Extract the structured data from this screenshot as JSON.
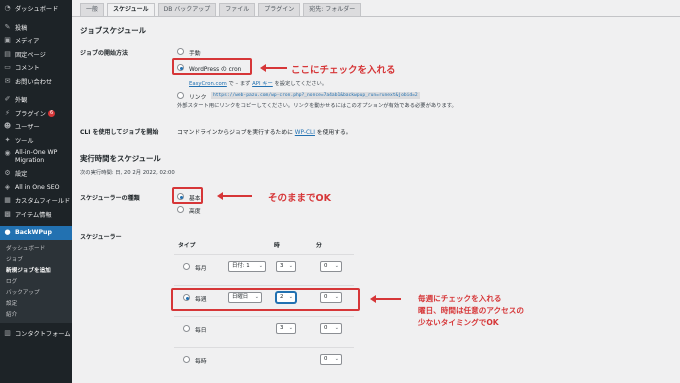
{
  "sidebar": {
    "items": [
      {
        "label": "ダッシュボード",
        "icon": "dashboard-icon",
        "glyph": "◔"
      },
      {
        "label": "投稿",
        "icon": "pin-icon",
        "glyph": "✎"
      },
      {
        "label": "メディア",
        "icon": "media-icon",
        "glyph": "▣"
      },
      {
        "label": "固定ページ",
        "icon": "page-icon",
        "glyph": "▤"
      },
      {
        "label": "コメント",
        "icon": "comment-icon",
        "glyph": "▭"
      },
      {
        "label": "お問い合わせ",
        "icon": "mail-icon",
        "glyph": "✉"
      },
      {
        "label": "外観",
        "icon": "brush-icon",
        "glyph": "✐"
      },
      {
        "label": "プラグイン",
        "icon": "plugin-icon",
        "glyph": "⚡",
        "badge": "6"
      },
      {
        "label": "ユーザー",
        "icon": "user-icon",
        "glyph": "☻"
      },
      {
        "label": "ツール",
        "icon": "wrench-icon",
        "glyph": "✦"
      },
      {
        "label": "All-in-One WP Migration",
        "icon": "migration-icon",
        "glyph": "◉"
      },
      {
        "label": "設定",
        "icon": "settings-icon",
        "glyph": "⚙"
      },
      {
        "label": "All in One SEO",
        "icon": "seo-icon",
        "glyph": "◈"
      },
      {
        "label": "カスタムフィールド",
        "icon": "fields-icon",
        "glyph": "▦"
      },
      {
        "label": "アイテム情報",
        "icon": "item-icon",
        "glyph": "▩"
      },
      {
        "label": "BackWPup",
        "icon": "backwpup-icon",
        "glyph": "●"
      },
      {
        "label": "コンタクトフォーム",
        "icon": "contact-form-icon",
        "glyph": "▥"
      }
    ],
    "submenu": [
      "ダッシュボード",
      "ジョブ",
      "新規ジョブを追加",
      "ログ",
      "バックアップ",
      "設定",
      "紹介"
    ]
  },
  "tabs": [
    "一般",
    "スケジュール",
    "DB バックアップ",
    "ファイル",
    "プラグイン",
    "宛先: フォルダー"
  ],
  "job_schedule": {
    "heading": "ジョブスケジュール",
    "start_label": "ジョブの開始方法",
    "opt_manual": "手動",
    "opt_wpcron": "WordPress の cron",
    "easycron_link": "EasyCron.com",
    "easycron_mid": " で – まず ",
    "api_key_link": "API キー",
    "easycron_tail": " を設定してください。",
    "opt_link": "リンク",
    "link_url": "https://web-pazu.com/wp-cron.php?_nonce=7a4ab1&backwpup_run=runext&jobid=2",
    "link_desc": "外部スタート用にリンクをコピーしてください。リンクを動かせるにはこのオプションが有効である必要があります。",
    "cli_label": "CLI を使用してジョブを開始",
    "cli_text_pre": "コマンドラインからジョブを実行するために ",
    "cli_link": "WP-CLI",
    "cli_text_post": " を使用する。"
  },
  "run_schedule": {
    "heading": "実行時間をスケジュール",
    "next_run": "次の実行時間: 日, 20 2月 2022, 02:00",
    "type_label": "スケジューラーの種類",
    "opt_basic": "基本",
    "opt_advanced": "高度",
    "scheduler_label": "スケジューラー",
    "col_type": "タイプ",
    "col_hour": "時",
    "col_min": "分",
    "rows": [
      {
        "label": "毎月",
        "day": "日付: 1",
        "hour": "3",
        "min": "0"
      },
      {
        "label": "毎週",
        "day": "日曜日",
        "hour": "2",
        "min": "0"
      },
      {
        "label": "毎日",
        "day": "",
        "hour": "3",
        "min": "0"
      },
      {
        "label": "毎時",
        "day": "",
        "hour": "",
        "min": "0"
      }
    ]
  },
  "annotations": {
    "cron": "ここにチェックを入れる",
    "basic": "そのままでOK",
    "weekly_1": "毎週にチェックを入れる",
    "weekly_2": "曜日、時間は任意のアクセスの",
    "weekly_3": "少ないタイミングでOK"
  },
  "colors": {
    "annotation_red": "#d63638",
    "sidebar_bg": "#1d2327",
    "accent_blue": "#2271b1"
  }
}
